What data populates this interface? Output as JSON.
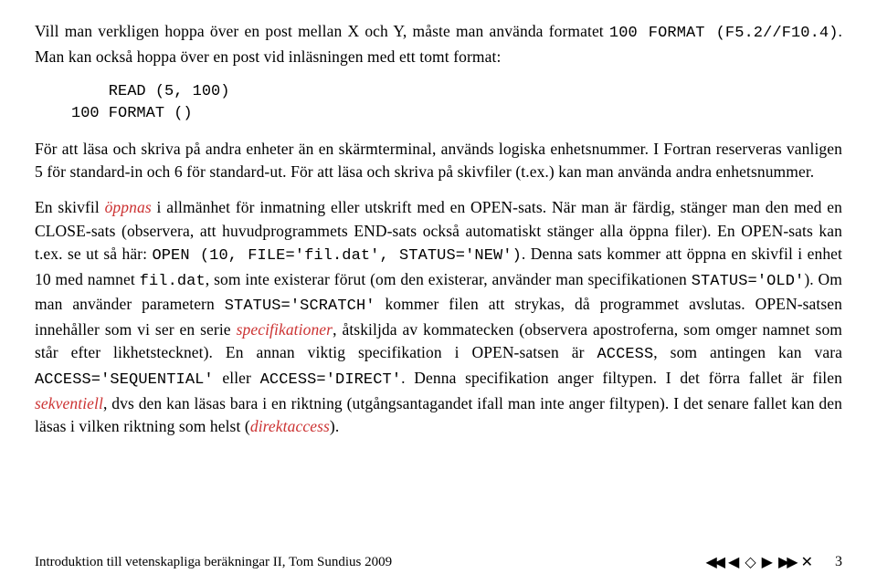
{
  "para1_a": "Vill man verkligen hoppa över en post mellan X och Y, måste man använda formatet ",
  "para1_code": "100 FORMAT (F5.2//F10.4)",
  "para1_b": ". Man kan också hoppa över en post vid inläsningen med ett tomt format:",
  "code_block": "    READ (5, 100)\n100 FORMAT ()",
  "para2_a": "För att läsa och skriva på andra enheter än en skärmterminal, används logiska enhetsnummer. I Fortran reserveras vanligen 5 för standard-in och 6 för standard-ut. För att läsa och skriva på skivfiler (t.ex.) kan man använda andra enhetsnummer.",
  "para3_a": "En skivfil ",
  "para3_red1": "öppnas",
  "para3_b": " i allmänhet för inmatning eller utskrift med en OPEN-sats. När man är färdig, stänger man den med en CLOSE-sats (observera, att huvudprogrammets END-sats också automatiskt stänger alla öppna filer). En OPEN-sats kan t.ex. se ut så här: ",
  "para3_code1": "OPEN (10, FILE='fil.dat', STATUS='NEW')",
  "para3_c": ". Denna sats kommer att öppna en skivfil i enhet 10 med namnet ",
  "para3_code2": "fil.dat",
  "para3_d": ", som inte existerar förut (om den existerar, använder man specifikationen ",
  "para3_code3": "STATUS='OLD'",
  "para3_e": "). Om man använder parametern ",
  "para3_code4": "STATUS='SCRATCH'",
  "para3_f": " kommer filen att strykas, då programmet avslutas. OPEN-satsen innehåller som vi ser en serie ",
  "para3_red2": "specifikationer",
  "para3_g": ", åtskiljda av kommatecken (observera apostroferna, som omger namnet som står efter likhetstecknet). En annan viktig specifikation i OPEN-satsen är ",
  "para3_code5": "ACCESS",
  "para3_h": ", som antingen kan vara ",
  "para3_code6": "ACCESS='SEQUENTIAL'",
  "para3_i": " eller ",
  "para3_code7": "ACCESS='DIRECT'",
  "para3_j": ". Denna specifikation anger filtypen. I det förra fallet är filen ",
  "para3_red3": "sekventiell",
  "para3_k": ", dvs den kan läsas bara i en riktning (utgångsantagandet ifall man inte anger filtypen). I det senare fallet kan den läsas i vilken riktning som helst (",
  "para3_red4": "direktaccess",
  "para3_l": ").",
  "footer_text": "Introduktion till vetenskapliga beräkningar II, Tom Sundius 2009",
  "page_number": "3"
}
